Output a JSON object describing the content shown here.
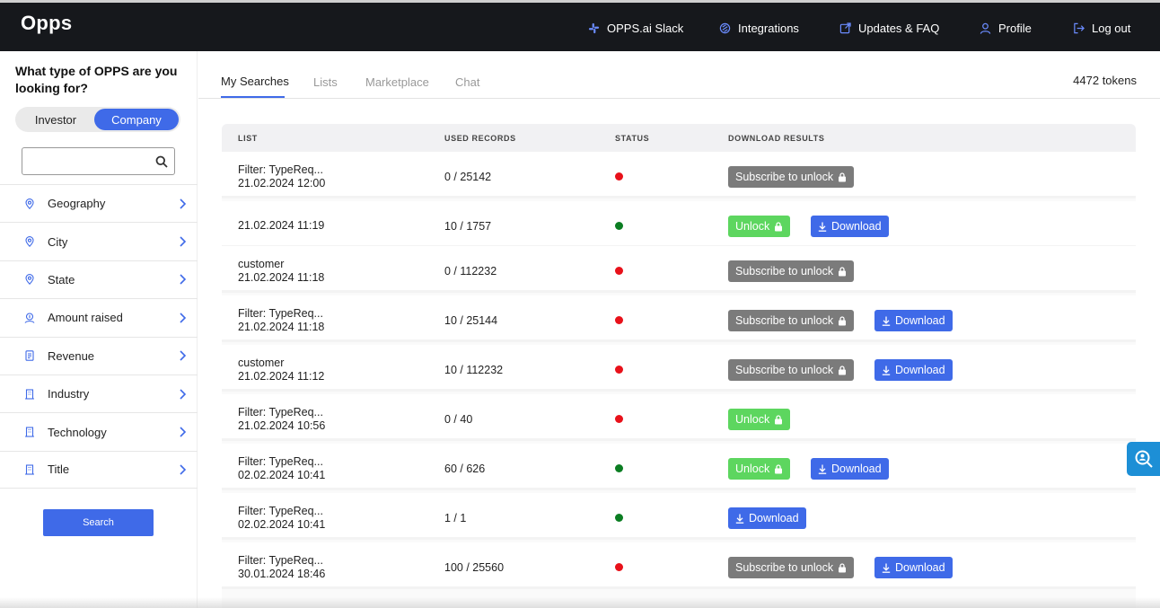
{
  "app": {
    "logo": "Opps"
  },
  "topnav": [
    {
      "label": "OPPS.ai Slack",
      "icon": "slack-icon"
    },
    {
      "label": "Integrations",
      "icon": "integrations-icon"
    },
    {
      "label": "Updates & FAQ",
      "icon": "external-link-icon"
    },
    {
      "label": "Profile",
      "icon": "user-icon"
    },
    {
      "label": "Log out",
      "icon": "logout-icon"
    }
  ],
  "sidebar": {
    "title": "What type of OPPS are you looking for?",
    "toggle": {
      "investor": "Investor",
      "company": "Company",
      "selected": "Company"
    },
    "search": {
      "value": "",
      "placeholder": ""
    },
    "filters": [
      {
        "label": "Geography",
        "icon": "location-pin-icon"
      },
      {
        "label": "City",
        "icon": "location-pin-icon"
      },
      {
        "label": "State",
        "icon": "location-pin-icon"
      },
      {
        "label": "Amount raised",
        "icon": "money-icon"
      },
      {
        "label": "Revenue",
        "icon": "document-icon"
      },
      {
        "label": "Industry",
        "icon": "building-icon"
      },
      {
        "label": "Technology",
        "icon": "building-icon"
      },
      {
        "label": "Title",
        "icon": "building-icon"
      }
    ],
    "search_button": "Search"
  },
  "main": {
    "tabs": [
      "My Searches",
      "Lists",
      "Marketplace",
      "Chat"
    ],
    "active_tab": "My Searches",
    "tokens": "4472 tokens",
    "table": {
      "headers": [
        "LIST",
        "USED RECORDS",
        "STATUS",
        "DOWNLOAD RESULTS"
      ],
      "rows": [
        {
          "list1": "Filter: TypeReq...",
          "list2": "21.02.2024 12:00",
          "records": "0 / 25142",
          "status": "red",
          "buttons": [
            {
              "type": "gray",
              "label": "Subscribe to unlock",
              "icon": "lock-icon"
            }
          ]
        },
        {
          "list1": "21.02.2024 11:19",
          "list2": "",
          "records": "10 / 1757",
          "status": "green",
          "buttons": [
            {
              "type": "green",
              "label": "Unlock",
              "icon": "lock-icon"
            },
            {
              "type": "blue",
              "label": "Download",
              "icon": "download-icon"
            }
          ]
        },
        {
          "list1": "customer",
          "list2": "21.02.2024 11:18",
          "records": "0 / 112232",
          "status": "red",
          "buttons": [
            {
              "type": "gray",
              "label": "Subscribe to unlock",
              "icon": "lock-icon"
            }
          ]
        },
        {
          "list1": "Filter: TypeReq...",
          "list2": "21.02.2024 11:18",
          "records": "10 / 25144",
          "status": "red",
          "buttons": [
            {
              "type": "gray",
              "label": "Subscribe to unlock",
              "icon": "lock-icon"
            },
            {
              "type": "blue",
              "label": "Download",
              "icon": "download-icon"
            }
          ]
        },
        {
          "list1": "customer",
          "list2": "21.02.2024 11:12",
          "records": "10 / 112232",
          "status": "red",
          "buttons": [
            {
              "type": "gray",
              "label": "Subscribe to unlock",
              "icon": "lock-icon"
            },
            {
              "type": "blue",
              "label": "Download",
              "icon": "download-icon"
            }
          ]
        },
        {
          "list1": "Filter: TypeReq...",
          "list2": "21.02.2024 10:56",
          "records": "0 / 40",
          "status": "red",
          "buttons": [
            {
              "type": "green",
              "label": "Unlock",
              "icon": "lock-icon"
            }
          ]
        },
        {
          "list1": "Filter: TypeReq...",
          "list2": "02.02.2024 10:41",
          "records": "60 / 626",
          "status": "green",
          "buttons": [
            {
              "type": "green",
              "label": "Unlock",
              "icon": "lock-icon"
            },
            {
              "type": "blue",
              "label": "Download",
              "icon": "download-icon"
            }
          ]
        },
        {
          "list1": "Filter: TypeReq...",
          "list2": "02.02.2024 10:41",
          "records": "1 / 1",
          "status": "green",
          "buttons": [
            {
              "type": "blue",
              "label": "Download",
              "icon": "download-icon"
            }
          ]
        },
        {
          "list1": "Filter: TypeReq...",
          "list2": "30.01.2024 18:46",
          "records": "100 / 25560",
          "status": "red",
          "buttons": [
            {
              "type": "gray",
              "label": "Subscribe to unlock",
              "icon": "lock-icon"
            },
            {
              "type": "blue",
              "label": "Download",
              "icon": "download-icon"
            }
          ]
        }
      ]
    }
  },
  "colors": {
    "accent": "#3f6ae8",
    "unlock": "#5dd65f",
    "locked": "#7b7b7b",
    "status_red": "#e8111a",
    "status_green": "#0b7d22",
    "topbar": "#16181c"
  },
  "floating_button": {
    "icon": "search-person-icon"
  }
}
